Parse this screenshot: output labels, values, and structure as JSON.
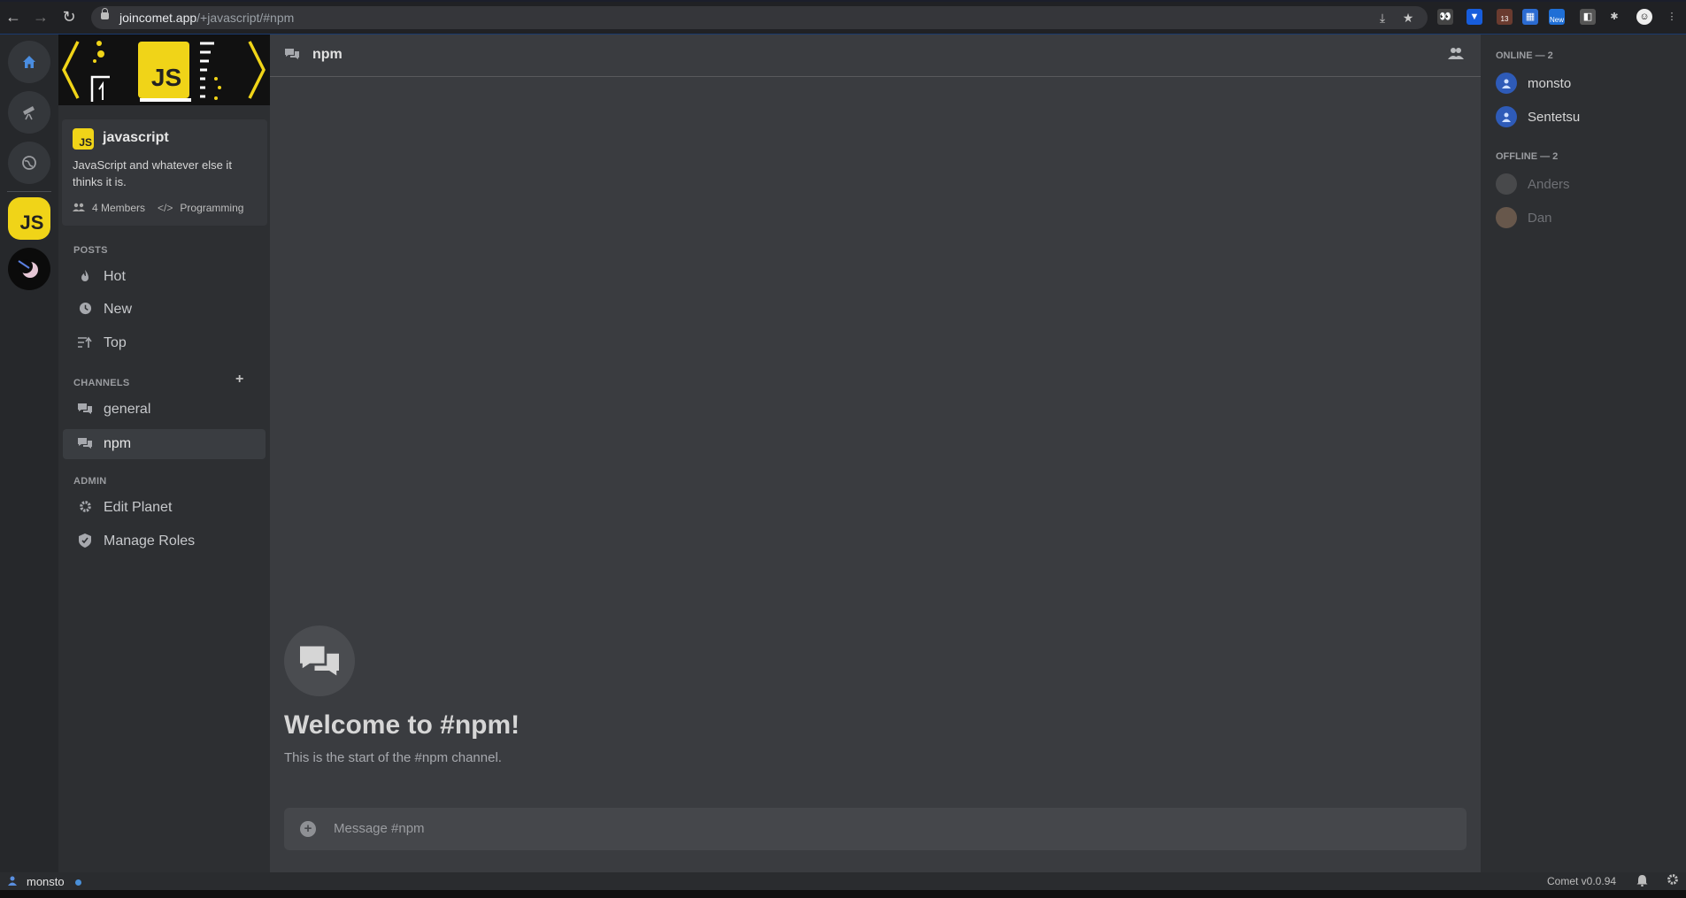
{
  "browser": {
    "url_host": "joincomet.app",
    "url_path": "/+javascript/#npm"
  },
  "planet": {
    "name": "javascript",
    "icon_text": "JS",
    "description": "JavaScript and whatever else it thinks it is.",
    "members": "4 Members",
    "category": "Programming",
    "accent": "#f0d418"
  },
  "sidebar": {
    "posts_label": "POSTS",
    "posts": [
      {
        "label": "Hot",
        "icon": "fire-icon"
      },
      {
        "label": "New",
        "icon": "clock-icon"
      },
      {
        "label": "Top",
        "icon": "sort-icon"
      }
    ],
    "channels_label": "CHANNELS",
    "channels": [
      {
        "label": "general",
        "icon": "chat-icon"
      },
      {
        "label": "npm",
        "icon": "chat-icon",
        "active": true
      }
    ],
    "admin_label": "ADMIN",
    "admin": [
      {
        "label": "Edit Planet",
        "icon": "gear-icon"
      },
      {
        "label": "Manage Roles",
        "icon": "shield-icon"
      }
    ]
  },
  "rail": {
    "icons": [
      "home-icon",
      "telescope-icon",
      "globe-icon",
      "js-planet-icon",
      "comet-planet-icon"
    ]
  },
  "main": {
    "channel_title": "npm",
    "welcome_title": "Welcome to #npm!",
    "welcome_sub": "This is the start of the #npm channel.",
    "composer_placeholder": "Message #npm"
  },
  "members": {
    "online_label": "ONLINE — 2",
    "online": [
      "monsto",
      "Sentetsu"
    ],
    "offline_label": "OFFLINE — 2",
    "offline": [
      "Anders",
      "Dan"
    ]
  },
  "statusbar": {
    "user": "monsto",
    "version": "Comet v0.0.94"
  },
  "extensions": {
    "badge_13": "13",
    "badge_new": "New"
  }
}
